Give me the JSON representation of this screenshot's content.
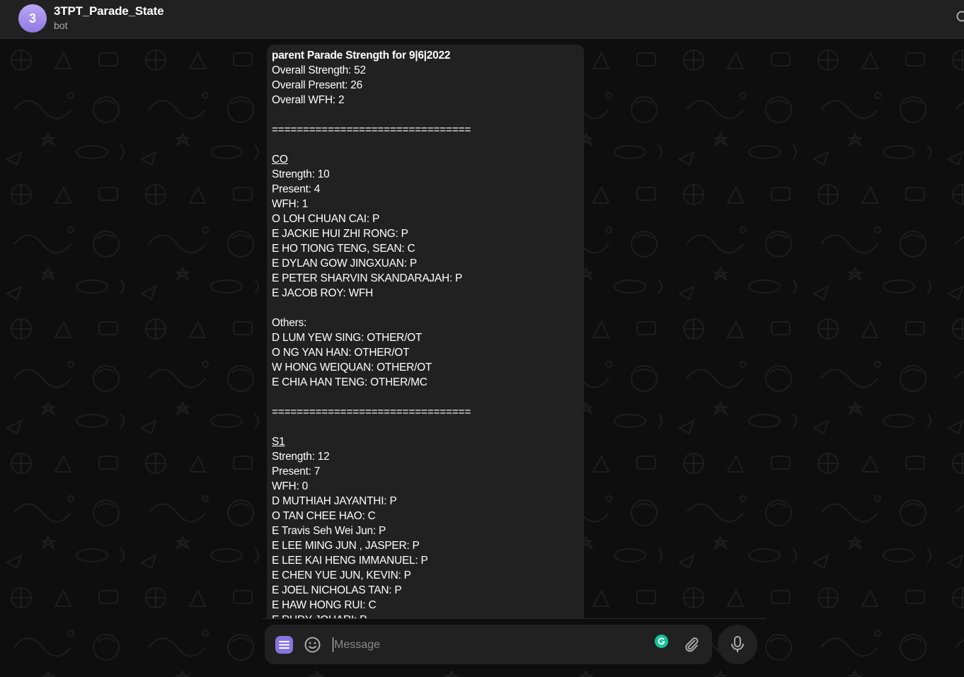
{
  "header": {
    "avatar_letter": "3",
    "title": "3TPT_Parade_State",
    "subtitle": "bot"
  },
  "message": {
    "lines": [
      {
        "text": "parent Parade Strength for 9|6|2022",
        "style": "title"
      },
      {
        "text": "Overall Strength: 52",
        "style": "normal"
      },
      {
        "text": "Overall Present: 26",
        "style": "normal"
      },
      {
        "text": "Overall WFH: 2",
        "style": "normal"
      },
      {
        "text": "",
        "style": "normal"
      },
      {
        "text": "================================",
        "style": "normal"
      },
      {
        "text": "",
        "style": "normal"
      },
      {
        "text": "CO",
        "style": "heading"
      },
      {
        "text": "Strength: 10",
        "style": "normal"
      },
      {
        "text": "Present: 4",
        "style": "normal"
      },
      {
        "text": "WFH: 1",
        "style": "normal"
      },
      {
        "text": "O LOH CHUAN CAI: P",
        "style": "normal"
      },
      {
        "text": "E JACKIE HUI ZHI RONG: P",
        "style": "normal"
      },
      {
        "text": "E HO TIONG TENG, SEAN: C",
        "style": "normal"
      },
      {
        "text": "E DYLAN GOW JINGXUAN: P",
        "style": "normal"
      },
      {
        "text": "E PETER SHARVIN SKANDARAJAH: P",
        "style": "normal"
      },
      {
        "text": "E JACOB ROY: WFH",
        "style": "normal"
      },
      {
        "text": "",
        "style": "normal"
      },
      {
        "text": "Others:",
        "style": "normal"
      },
      {
        "text": "D LUM YEW SING: OTHER/OT",
        "style": "normal"
      },
      {
        "text": "O NG YAN HAN: OTHER/OT",
        "style": "normal"
      },
      {
        "text": "W HONG WEIQUAN: OTHER/OT",
        "style": "normal"
      },
      {
        "text": "E CHIA HAN TENG: OTHER/MC",
        "style": "normal"
      },
      {
        "text": "",
        "style": "normal"
      },
      {
        "text": "================================",
        "style": "normal"
      },
      {
        "text": "",
        "style": "normal"
      },
      {
        "text": "S1",
        "style": "heading"
      },
      {
        "text": "Strength: 12",
        "style": "normal"
      },
      {
        "text": "Present: 7",
        "style": "normal"
      },
      {
        "text": "WFH: 0",
        "style": "normal"
      },
      {
        "text": "D MUTHIAH JAYANTHI: P",
        "style": "normal"
      },
      {
        "text": "O TAN CHEE HAO: C",
        "style": "normal"
      },
      {
        "text": "E Travis Seh Wei Jun: P",
        "style": "normal"
      },
      {
        "text": "E LEE MING JUN , JASPER: P",
        "style": "normal"
      },
      {
        "text": "E LEE KAI HENG IMMANUEL: P",
        "style": "normal"
      },
      {
        "text": "E CHEN YUE JUN, KEVIN: P",
        "style": "normal"
      },
      {
        "text": "E JOEL NICHOLAS TAN: P",
        "style": "normal"
      },
      {
        "text": "E HAW HONG RUI: C",
        "style": "normal"
      },
      {
        "text": "E RUDY JOHARI: P",
        "style": "normal"
      }
    ]
  },
  "composer": {
    "placeholder": "Message",
    "value": ""
  },
  "icons": {
    "menu": "bot-menu-icon",
    "emoji": "emoji-icon",
    "grammarly": "grammarly-icon",
    "attach": "paperclip-icon",
    "mic": "microphone-icon",
    "search": "search-icon"
  },
  "colors": {
    "header_bg": "#212121",
    "chat_bg": "#0e0e0e",
    "bubble_bg": "#212121",
    "accent": "#8774e1",
    "avatar_bg": "#a995ec",
    "grammarly": "#15c39a"
  }
}
